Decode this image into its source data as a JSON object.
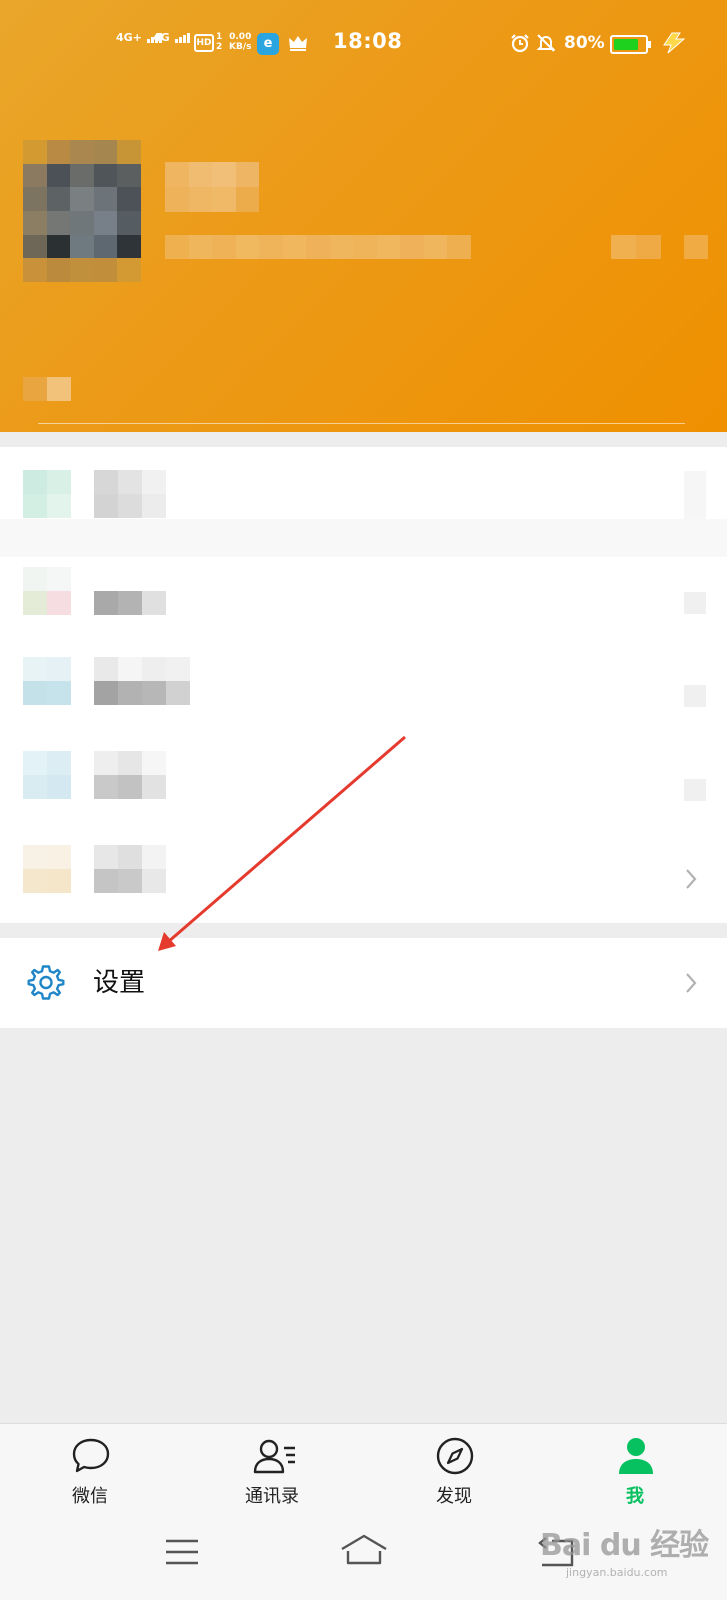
{
  "status_bar": {
    "net1": "4G+",
    "net2": "4G",
    "hd": "HD",
    "hd_sim1": "1",
    "hd_sim2": "2",
    "speed_value": "0.00",
    "speed_unit": "KB/s",
    "time": "18:08",
    "battery_percent": "80%",
    "battery_level": 0.8
  },
  "menu": {
    "settings_label": "设置"
  },
  "tabbar": {
    "tabs": [
      {
        "label": "微信",
        "icon": "chat-bubble-icon",
        "active": false
      },
      {
        "label": "通讯录",
        "icon": "contacts-icon",
        "active": false
      },
      {
        "label": "发现",
        "icon": "compass-icon",
        "active": false
      },
      {
        "label": "我",
        "icon": "person-icon",
        "active": true
      }
    ]
  },
  "watermark": {
    "text": "Bai du 经验",
    "sub": "jingyan.baidu.com"
  },
  "colors": {
    "header_orange": "#ee9a13",
    "accent_green": "#07c160",
    "settings_icon_blue": "#1f86c8",
    "annotation_arrow": "#e53a2e"
  }
}
